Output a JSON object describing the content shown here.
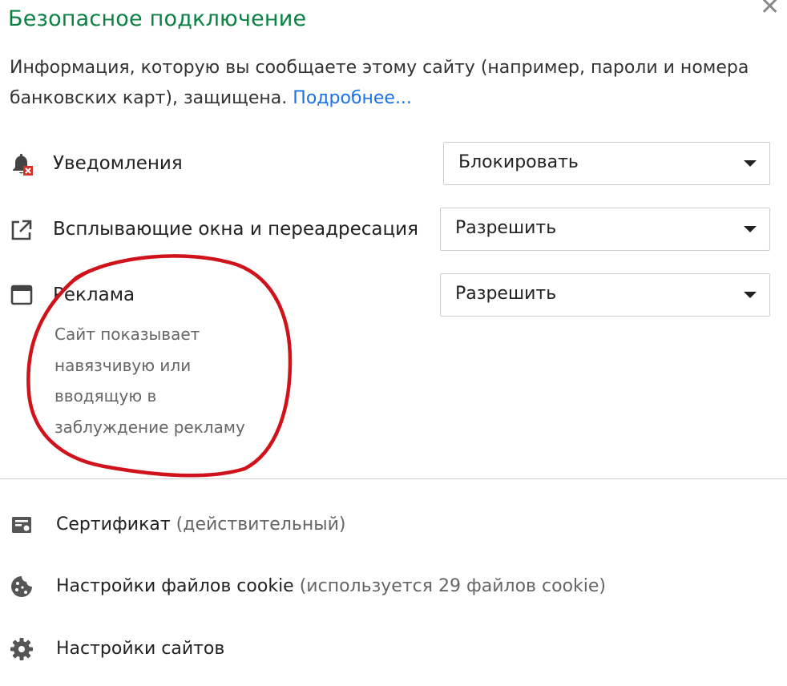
{
  "header": {
    "title": "Безопасное подключение",
    "close_icon": "close-icon"
  },
  "info": {
    "text": "Информация, которую вы сообщаете этому сайту (например, пароли и номера банковских карт), защищена.",
    "more_link": "Подробнее..."
  },
  "permissions": [
    {
      "icon": "notification-blocked-icon",
      "label": "Уведомления",
      "value": "Блокировать"
    },
    {
      "icon": "popup-redirect-icon",
      "label": "Всплывающие окна и переадресация",
      "value": "Разрешить"
    },
    {
      "icon": "ads-window-icon",
      "label": "Реклама",
      "value": "Разрешить",
      "description": [
        "Сайт показывает",
        "навязчивую или",
        "вводящую в",
        "заблуждение рекламу"
      ]
    }
  ],
  "links": [
    {
      "icon": "certificate-icon",
      "label": "Сертификат",
      "detail": "(действительный)"
    },
    {
      "icon": "cookie-icon",
      "label": "Настройки файлов cookie",
      "detail": "(используется 29 файлов cookie)"
    },
    {
      "icon": "gear-icon",
      "label": "Настройки сайтов",
      "detail": ""
    }
  ],
  "annotation": {
    "color": "#d0121b",
    "shape": "hand-drawn circle around Реклама"
  }
}
